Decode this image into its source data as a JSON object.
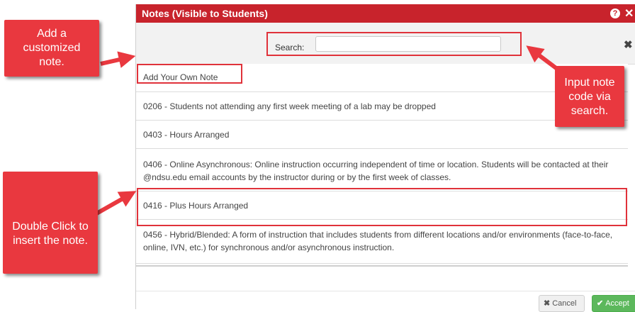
{
  "dialog": {
    "title": "Notes (Visible to Students)",
    "help_icon": "?",
    "close_icon": "✕",
    "search_label": "Search:",
    "search_value": "",
    "clear_icon": "✖",
    "notes": [
      "Add Your Own Note",
      "0206 - Students not attending any first week meeting of a lab may be dropped",
      "0403 - Hours Arranged",
      "0406 - Online Asynchronous: Online instruction occurring independent of time or location. Students will be contacted at their @ndsu.edu email accounts by the instructor during or by the first week of classes.",
      "0416 - Plus Hours Arranged",
      "0456 - Hybrid/Blended: A form of instruction that includes students from different locations and/or environments (face-to-face, online, IVN, etc.) for synchronous and/or asynchronous instruction."
    ],
    "cancel_label": "Cancel",
    "accept_label": "Accept"
  },
  "annotations": {
    "add_note": "Add a customized note.",
    "search_tip": "Input note code via search.",
    "double_click": "Double Click to insert the note."
  },
  "colors": {
    "titlebar": "#c8232c",
    "callout": "#e9383f",
    "accept": "#5cb85c"
  }
}
